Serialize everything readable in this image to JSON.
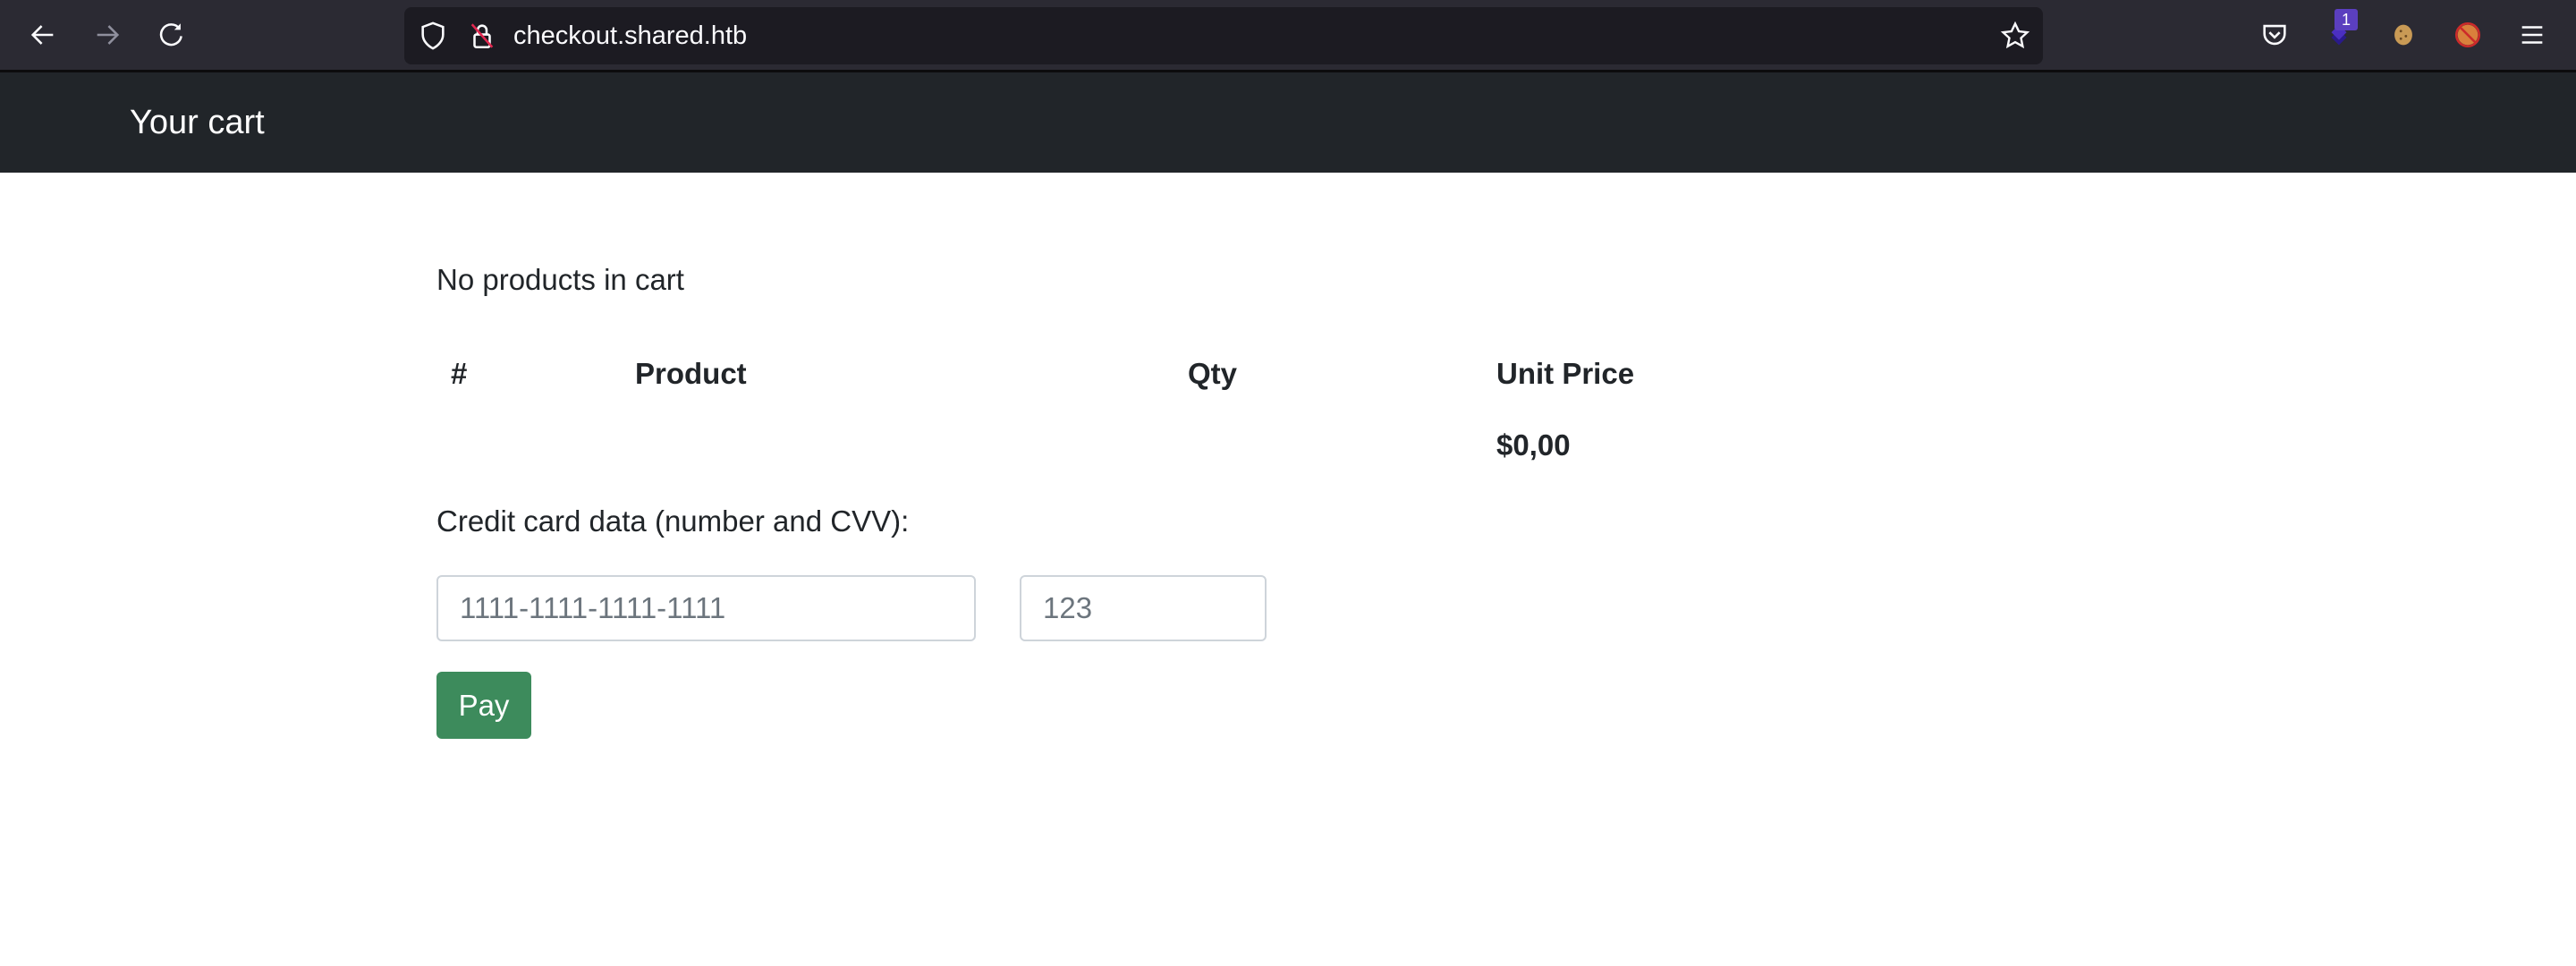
{
  "browser": {
    "url": "checkout.shared.htb",
    "extension_badge_count": "1",
    "icons": [
      "back-arrow-icon",
      "forward-arrow-icon",
      "reload-icon",
      "shield-icon",
      "insecure-lock-icon",
      "bookmark-star-icon",
      "pocket-icon",
      "extension-stack-icon",
      "cookie-icon",
      "fox-blocked-icon",
      "hamburger-menu-icon"
    ]
  },
  "navbar": {
    "title": "Your cart"
  },
  "cart": {
    "empty_message": "No products in cart",
    "columns": [
      "#",
      "Product",
      "Qty",
      "Unit Price"
    ],
    "rows": [],
    "total": "$0,00"
  },
  "payment": {
    "label": "Credit card data (number and CVV):",
    "card_number": {
      "value": "",
      "placeholder": "1111-1111-1111-1111"
    },
    "cvv": {
      "value": "",
      "placeholder": "123"
    },
    "pay_label": "Pay"
  },
  "colors": {
    "navbar_bg": "#212529",
    "pay_button": "#3d8b5c",
    "toolbar_bg": "#2b2a33"
  }
}
